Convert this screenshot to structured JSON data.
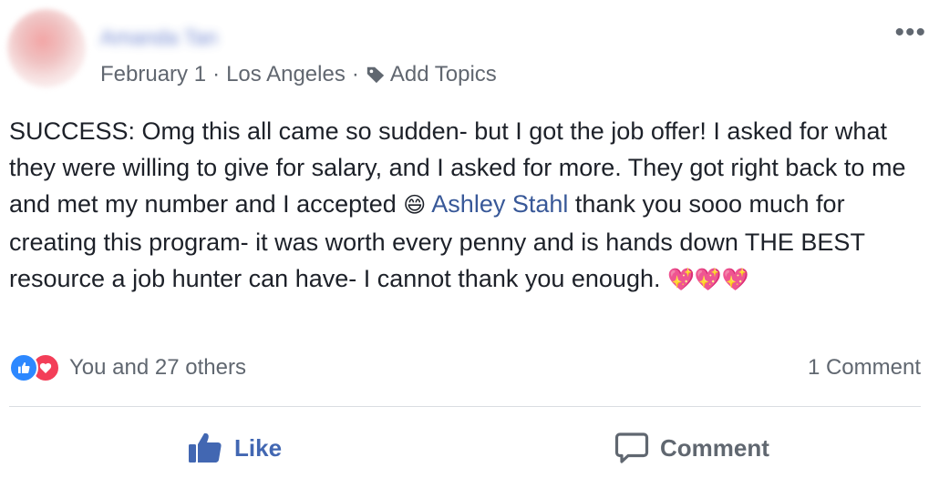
{
  "post": {
    "author": "Amanda Tan",
    "date": "February 1",
    "separator": "·",
    "location": "Los Angeles",
    "add_topics": "Add Topics",
    "more_icon": "more-options-icon",
    "more_glyph": "•••",
    "body": {
      "part1": "SUCCESS: Omg this all came so sudden- but I got the job offer! I asked for what they were willing to give for salary, and I asked for more. They got right back to me and met my number and I accepted ",
      "emoji_smile": "😄",
      "mention": "Ashley Stahl",
      "part2": " thank you sooo much for creating this program- it was worth every penny and is hands down THE BEST resource a job hunter can have- I cannot thank you enough. ",
      "emoji_hearts": "💖💖💖"
    }
  },
  "reactions": {
    "summary": "You and 27 others",
    "icons": [
      "like-icon",
      "love-icon"
    ]
  },
  "comments": {
    "count_label": "1 Comment"
  },
  "actions": {
    "like_label": "Like",
    "comment_label": "Comment"
  },
  "colors": {
    "like_blue": "#4267b2",
    "mention_blue": "#385898",
    "love_red": "#f33e58",
    "meta_gray": "#616770"
  }
}
